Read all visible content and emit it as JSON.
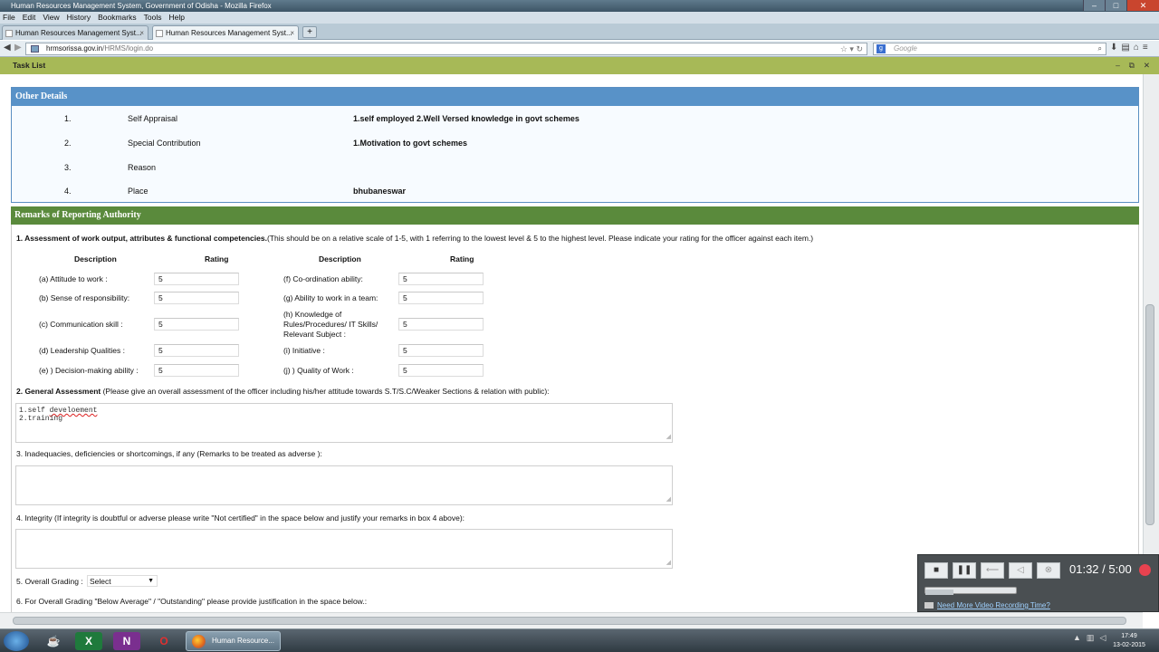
{
  "window": {
    "title": "Human Resources Management System, Government of Odisha - Mozilla Firefox",
    "controls": [
      "–",
      "□",
      "✕"
    ]
  },
  "menu": [
    "File",
    "Edit",
    "View",
    "History",
    "Bookmarks",
    "Tools",
    "Help"
  ],
  "tabs": [
    {
      "label": "Human Resources Management Syst...",
      "active": false
    },
    {
      "label": "Human Resources Management Syst...",
      "active": true
    }
  ],
  "newtab_label": "+",
  "address": {
    "host": "hrmsorissa.gov.in",
    "path": "/HRMS/login.do"
  },
  "search": {
    "placeholder": "Google",
    "engine_letter": "g"
  },
  "tasklist": {
    "label": "Task List"
  },
  "other_details": {
    "heading": "Other Details",
    "rows": [
      {
        "num": "1.",
        "label": "Self Appraisal",
        "value": "1.self employed 2.Well Versed knowledge in govt schemes"
      },
      {
        "num": "2.",
        "label": "Special Contribution",
        "value": "1.Motivation to govt schemes"
      },
      {
        "num": "3.",
        "label": "Reason",
        "value": ""
      },
      {
        "num": "4.",
        "label": "Place",
        "value": "bhubaneswar"
      }
    ]
  },
  "remarks": {
    "heading": "Remarks of Reporting Authority",
    "q1_bold": "1. Assessment of work output, attributes & functional competencies.",
    "q1_rest": "(This should be on a relative scale of 1-5, with 1 referring to the lowest level & 5 to the highest level. Please indicate your rating for the officer against each item.)",
    "col_description": "Description",
    "col_rating": "Rating",
    "left_items": [
      {
        "label": "(a) Attitude to work :",
        "rating": "5"
      },
      {
        "label": "(b) Sense of responsibility:",
        "rating": "5"
      },
      {
        "label": "(c) Communication skill :",
        "rating": "5"
      },
      {
        "label": "(d) Leadership Qualities :",
        "rating": "5"
      },
      {
        "label": "(e) ) Decision-making ability :",
        "rating": "5"
      }
    ],
    "right_items": [
      {
        "label": "(f) Co-ordination ability:",
        "rating": "5"
      },
      {
        "label": "(g) Ability to work in a team:",
        "rating": "5"
      },
      {
        "label": "(h) Knowledge of Rules/Procedures/ IT Skills/ Relevant Subject :",
        "rating": "5"
      },
      {
        "label": "(i) Initiative :",
        "rating": "5"
      },
      {
        "label": "(j) ) Quality of Work :",
        "rating": "5"
      }
    ],
    "q2_bold": "2. General Assessment",
    "q2_rest": " (Please give an overall assessment of the officer including his/her attitude towards S.T/S.C/Weaker Sections & relation with public):",
    "q2_line1_a": "1.self ",
    "q2_line1_b": "develoement",
    "q2_line2": "2.training",
    "q3": "3. Inadequacies, deficiencies or shortcomings, if any (Remarks to be treated as adverse ):",
    "q4": "4. Integrity (If integrity is doubtful or adverse please write \"Not certified\" in the space below and justify your remarks in box 4 above):",
    "q5_label": "5. Overall Grading :",
    "q5_selected": "Select",
    "q6": "6. For Overall Grading \"Below Average\" / \"Outstanding\" please provide justification in the space below.:"
  },
  "recorder": {
    "time": "01:32 / 5:00",
    "link": "Need More Video Recording Time?",
    "progress": 0.31
  },
  "taskbar": {
    "active_task": "Human Resource...",
    "time": "17:49",
    "date": "13-02-2015",
    "app_letters": [
      "X",
      "N",
      "O"
    ]
  }
}
